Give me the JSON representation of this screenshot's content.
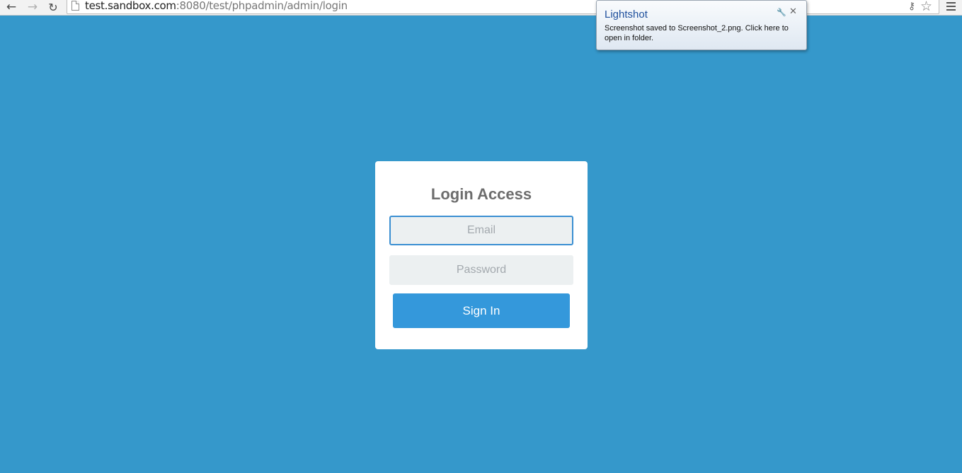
{
  "browser": {
    "url_host": "test.sandbox.com",
    "url_rest": ":8080/test/phpadmin/admin/login",
    "icons": {
      "back": "arrow-left-icon",
      "forward": "arrow-right-icon",
      "reload": "reload-icon",
      "page": "page-icon",
      "key": "key-icon",
      "bookmark": "star-icon",
      "menu": "menu-icon"
    }
  },
  "notification": {
    "title": "Lightshot",
    "message": "Screenshot saved to Screenshot_2.png. Click here to open in folder.",
    "close_glyph": "✕"
  },
  "login": {
    "title": "Login Access",
    "email_placeholder": "Email",
    "password_placeholder": "Password",
    "submit_label": "Sign In"
  },
  "colors": {
    "background": "#3598cb",
    "button": "#3498db",
    "input_bg": "#ecf0f1",
    "focus_border": "#3a8fd2"
  }
}
